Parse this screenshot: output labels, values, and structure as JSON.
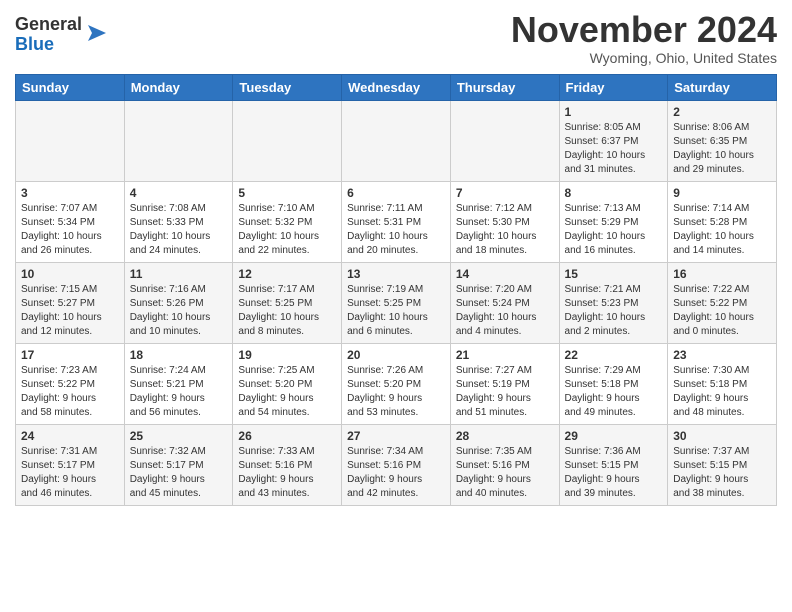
{
  "logo": {
    "general": "General",
    "blue": "Blue"
  },
  "title": "November 2024",
  "location": "Wyoming, Ohio, United States",
  "weekdays": [
    "Sunday",
    "Monday",
    "Tuesday",
    "Wednesday",
    "Thursday",
    "Friday",
    "Saturday"
  ],
  "weeks": [
    [
      {
        "day": "",
        "info": ""
      },
      {
        "day": "",
        "info": ""
      },
      {
        "day": "",
        "info": ""
      },
      {
        "day": "",
        "info": ""
      },
      {
        "day": "",
        "info": ""
      },
      {
        "day": "1",
        "info": "Sunrise: 8:05 AM\nSunset: 6:37 PM\nDaylight: 10 hours\nand 31 minutes."
      },
      {
        "day": "2",
        "info": "Sunrise: 8:06 AM\nSunset: 6:35 PM\nDaylight: 10 hours\nand 29 minutes."
      }
    ],
    [
      {
        "day": "3",
        "info": "Sunrise: 7:07 AM\nSunset: 5:34 PM\nDaylight: 10 hours\nand 26 minutes."
      },
      {
        "day": "4",
        "info": "Sunrise: 7:08 AM\nSunset: 5:33 PM\nDaylight: 10 hours\nand 24 minutes."
      },
      {
        "day": "5",
        "info": "Sunrise: 7:10 AM\nSunset: 5:32 PM\nDaylight: 10 hours\nand 22 minutes."
      },
      {
        "day": "6",
        "info": "Sunrise: 7:11 AM\nSunset: 5:31 PM\nDaylight: 10 hours\nand 20 minutes."
      },
      {
        "day": "7",
        "info": "Sunrise: 7:12 AM\nSunset: 5:30 PM\nDaylight: 10 hours\nand 18 minutes."
      },
      {
        "day": "8",
        "info": "Sunrise: 7:13 AM\nSunset: 5:29 PM\nDaylight: 10 hours\nand 16 minutes."
      },
      {
        "day": "9",
        "info": "Sunrise: 7:14 AM\nSunset: 5:28 PM\nDaylight: 10 hours\nand 14 minutes."
      }
    ],
    [
      {
        "day": "10",
        "info": "Sunrise: 7:15 AM\nSunset: 5:27 PM\nDaylight: 10 hours\nand 12 minutes."
      },
      {
        "day": "11",
        "info": "Sunrise: 7:16 AM\nSunset: 5:26 PM\nDaylight: 10 hours\nand 10 minutes."
      },
      {
        "day": "12",
        "info": "Sunrise: 7:17 AM\nSunset: 5:25 PM\nDaylight: 10 hours\nand 8 minutes."
      },
      {
        "day": "13",
        "info": "Sunrise: 7:19 AM\nSunset: 5:25 PM\nDaylight: 10 hours\nand 6 minutes."
      },
      {
        "day": "14",
        "info": "Sunrise: 7:20 AM\nSunset: 5:24 PM\nDaylight: 10 hours\nand 4 minutes."
      },
      {
        "day": "15",
        "info": "Sunrise: 7:21 AM\nSunset: 5:23 PM\nDaylight: 10 hours\nand 2 minutes."
      },
      {
        "day": "16",
        "info": "Sunrise: 7:22 AM\nSunset: 5:22 PM\nDaylight: 10 hours\nand 0 minutes."
      }
    ],
    [
      {
        "day": "17",
        "info": "Sunrise: 7:23 AM\nSunset: 5:22 PM\nDaylight: 9 hours\nand 58 minutes."
      },
      {
        "day": "18",
        "info": "Sunrise: 7:24 AM\nSunset: 5:21 PM\nDaylight: 9 hours\nand 56 minutes."
      },
      {
        "day": "19",
        "info": "Sunrise: 7:25 AM\nSunset: 5:20 PM\nDaylight: 9 hours\nand 54 minutes."
      },
      {
        "day": "20",
        "info": "Sunrise: 7:26 AM\nSunset: 5:20 PM\nDaylight: 9 hours\nand 53 minutes."
      },
      {
        "day": "21",
        "info": "Sunrise: 7:27 AM\nSunset: 5:19 PM\nDaylight: 9 hours\nand 51 minutes."
      },
      {
        "day": "22",
        "info": "Sunrise: 7:29 AM\nSunset: 5:18 PM\nDaylight: 9 hours\nand 49 minutes."
      },
      {
        "day": "23",
        "info": "Sunrise: 7:30 AM\nSunset: 5:18 PM\nDaylight: 9 hours\nand 48 minutes."
      }
    ],
    [
      {
        "day": "24",
        "info": "Sunrise: 7:31 AM\nSunset: 5:17 PM\nDaylight: 9 hours\nand 46 minutes."
      },
      {
        "day": "25",
        "info": "Sunrise: 7:32 AM\nSunset: 5:17 PM\nDaylight: 9 hours\nand 45 minutes."
      },
      {
        "day": "26",
        "info": "Sunrise: 7:33 AM\nSunset: 5:16 PM\nDaylight: 9 hours\nand 43 minutes."
      },
      {
        "day": "27",
        "info": "Sunrise: 7:34 AM\nSunset: 5:16 PM\nDaylight: 9 hours\nand 42 minutes."
      },
      {
        "day": "28",
        "info": "Sunrise: 7:35 AM\nSunset: 5:16 PM\nDaylight: 9 hours\nand 40 minutes."
      },
      {
        "day": "29",
        "info": "Sunrise: 7:36 AM\nSunset: 5:15 PM\nDaylight: 9 hours\nand 39 minutes."
      },
      {
        "day": "30",
        "info": "Sunrise: 7:37 AM\nSunset: 5:15 PM\nDaylight: 9 hours\nand 38 minutes."
      }
    ]
  ]
}
